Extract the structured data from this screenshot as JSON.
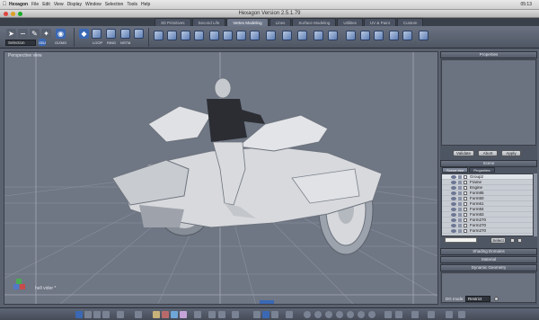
{
  "system_menu": {
    "app_name": "Hexagon",
    "items": [
      "File",
      "Edit",
      "View",
      "Display",
      "Window",
      "Selection",
      "Tools",
      "Help"
    ],
    "clock": "05:13"
  },
  "window": {
    "title": "Hexagon Version 2.5.1.79"
  },
  "tabs": [
    {
      "label": "3D Primitives",
      "active": false
    },
    {
      "label": "Second Life",
      "active": false
    },
    {
      "label": "Vertex Modeling",
      "active": true
    },
    {
      "label": "Lines",
      "active": false
    },
    {
      "label": "Surface Modeling",
      "active": false
    },
    {
      "label": "Utilities",
      "active": false
    },
    {
      "label": "UV & Paint",
      "active": false
    },
    {
      "label": "Custom",
      "active": false
    }
  ],
  "toolbar": {
    "selection_dropdown": "Selection",
    "labels": {
      "loop": "LOOP",
      "ring": "RING",
      "nstm": "NSTM",
      "gizmo": "GIZMO",
      "obj": "OBJ"
    }
  },
  "viewport": {
    "title": "Perspective view",
    "camera_label": "hell vider *",
    "colors": {
      "background": "#6f7684",
      "grid": "#8a91a0",
      "model": "#d8dade"
    }
  },
  "panels": {
    "properties": {
      "header": "Properties",
      "buttons": {
        "validate": "Validate",
        "abort": "Abort",
        "apply": "Apply"
      }
    },
    "scene": {
      "header": "Scene",
      "tabs": [
        {
          "label": "Scene tree",
          "active": true
        },
        {
          "label": "Properties",
          "active": false
        }
      ],
      "items": [
        {
          "name": "Group2",
          "selected": true
        },
        {
          "name": "Frame",
          "selected": false
        },
        {
          "name": "Engine",
          "selected": false
        },
        {
          "name": "Form85",
          "selected": false
        },
        {
          "name": "Form50",
          "selected": false
        },
        {
          "name": "Form61",
          "selected": false
        },
        {
          "name": "Form84",
          "selected": false
        },
        {
          "name": "Form83",
          "selected": false
        },
        {
          "name": "Form270",
          "selected": false
        },
        {
          "name": "Form270",
          "selected": false
        },
        {
          "name": "Form270",
          "selected": false
        }
      ],
      "select_button": "Select"
    },
    "shading": {
      "header": "Shading Domains"
    },
    "material": {
      "header": "Material"
    },
    "dynamic_geometry": {
      "header": "Dynamic Geometry",
      "mode_label": "DG mode:",
      "mode_value": "Restrict"
    }
  }
}
